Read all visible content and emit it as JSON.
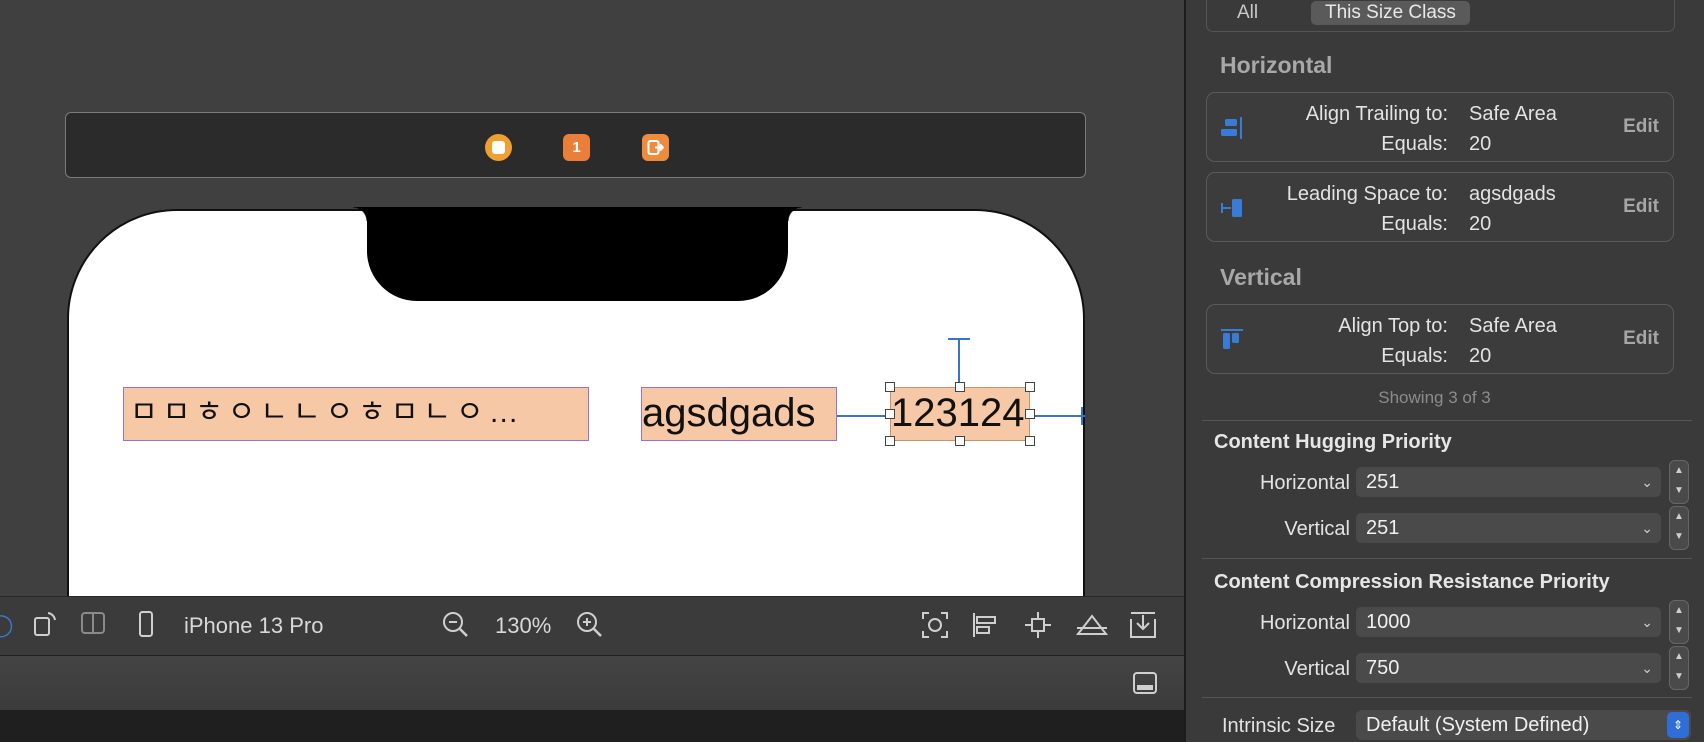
{
  "scene": {
    "icons": [
      "circle-stop-icon",
      "first-responder-icon",
      "exit-icon"
    ],
    "first_responder_label": "1"
  },
  "canvas_labels": {
    "label1": "ㅁㅁㅎㅇㄴㄴㅇㅎㅁㄴㅇ…",
    "label2": "agsdgads",
    "label3": "123124"
  },
  "bottom_bar": {
    "device": "iPhone 13 Pro",
    "zoom": "130%"
  },
  "inspector": {
    "tabs": [
      "All",
      "This Size Class"
    ],
    "horizontal_title": "Horizontal",
    "vertical_title": "Vertical",
    "constraints": [
      {
        "k1": "Align Trailing to:",
        "v1": "Safe Area",
        "k2": "Equals:",
        "v2": "20",
        "edit": "Edit"
      },
      {
        "k1": "Leading Space to:",
        "v1": "agsdgads",
        "k2": "Equals:",
        "v2": "20",
        "edit": "Edit"
      },
      {
        "k1": "Align Top to:",
        "v1": "Safe Area",
        "k2": "Equals:",
        "v2": "20",
        "edit": "Edit"
      }
    ],
    "showing": "Showing 3 of 3",
    "hugging": {
      "title": "Content Hugging Priority",
      "h_label": "Horizontal",
      "h_value": "251",
      "v_label": "Vertical",
      "v_value": "251"
    },
    "compression": {
      "title": "Content Compression Resistance Priority",
      "h_label": "Horizontal",
      "h_value": "1000",
      "v_label": "Vertical",
      "v_value": "750"
    },
    "intrinsic": {
      "label": "Intrinsic Size",
      "value": "Default (System Defined)"
    }
  },
  "colors": {
    "accent": "#3a73c9",
    "label_fill": "#f6c8a5",
    "label_border": "#8f73d6"
  }
}
